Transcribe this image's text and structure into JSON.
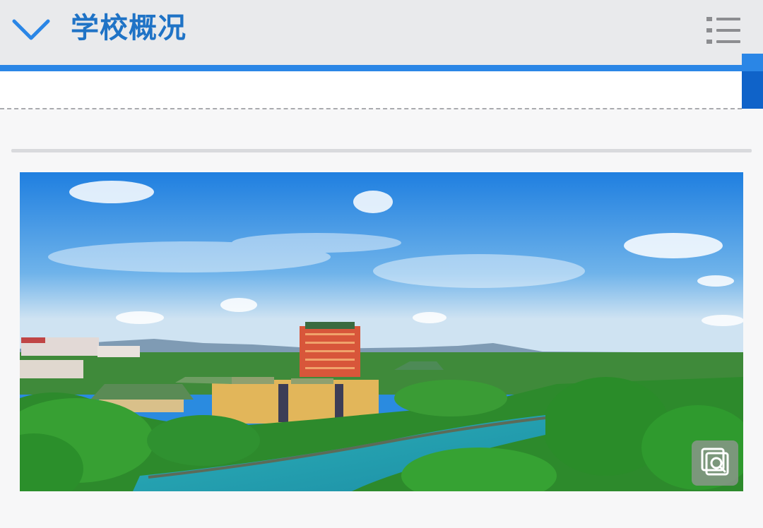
{
  "header": {
    "title": "学校概况",
    "back_icon": "chevron-down-icon",
    "menu_icon": "list-menu-icon"
  },
  "colors": {
    "accent": "#1f73c6",
    "bar": "#2a86e6",
    "tab": "#0f63c9"
  },
  "photo": {
    "zoom_icon": "zoom-icon"
  }
}
